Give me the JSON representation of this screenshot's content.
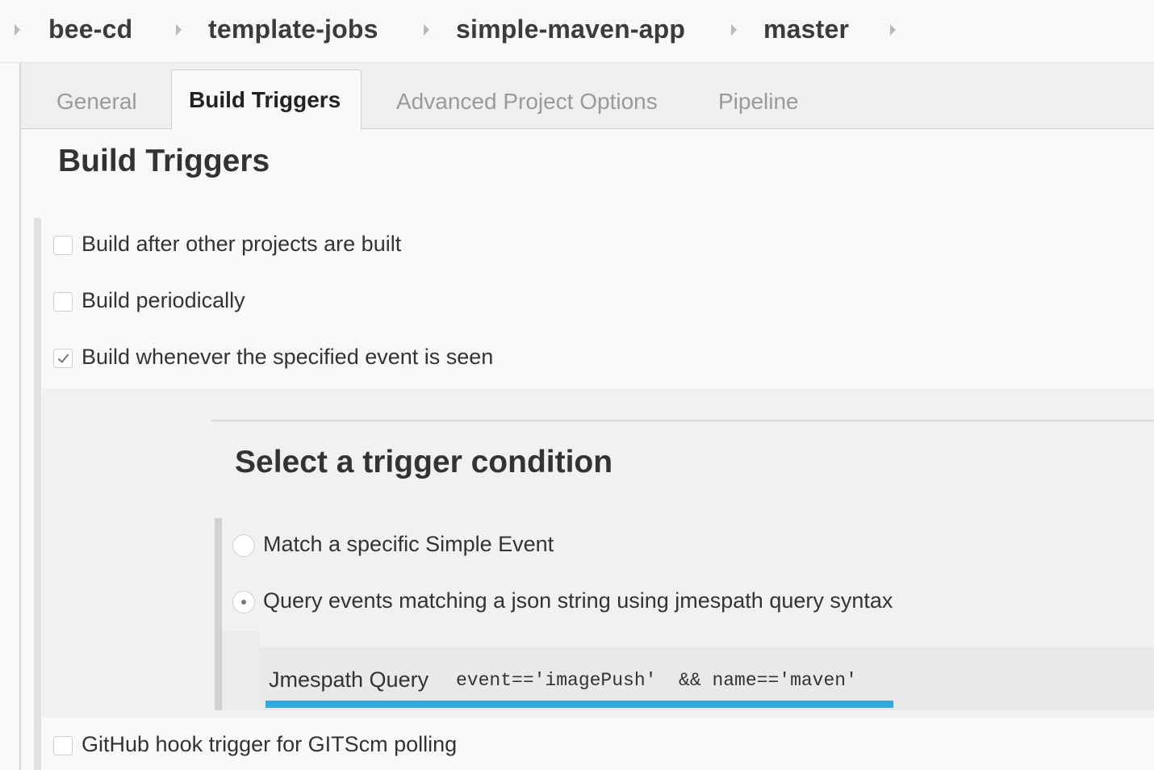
{
  "breadcrumb": {
    "items": [
      "bee-cd",
      "template-jobs",
      "simple-maven-app",
      "master"
    ]
  },
  "tabs": [
    {
      "label": "General",
      "active": false
    },
    {
      "label": "Build Triggers",
      "active": true
    },
    {
      "label": "Advanced Project Options",
      "active": false
    },
    {
      "label": "Pipeline",
      "active": false
    }
  ],
  "section": {
    "title": "Build Triggers"
  },
  "triggers": [
    {
      "label": "Build after other projects are built",
      "checked": false
    },
    {
      "label": "Build periodically",
      "checked": false
    },
    {
      "label": "Build whenever the specified event is seen",
      "checked": true
    },
    {
      "label": "GitHub hook trigger for GITScm polling",
      "checked": false
    }
  ],
  "condition": {
    "title": "Select a trigger condition",
    "options": [
      {
        "label": "Match a specific Simple Event",
        "selected": false
      },
      {
        "label": "Query events matching a json string using jmespath query syntax",
        "selected": true
      }
    ],
    "query_label": "Jmespath Query",
    "query_value": "event=='imagePush'  && name=='maven'"
  },
  "colors": {
    "accent_underline": "#2fa9de"
  }
}
